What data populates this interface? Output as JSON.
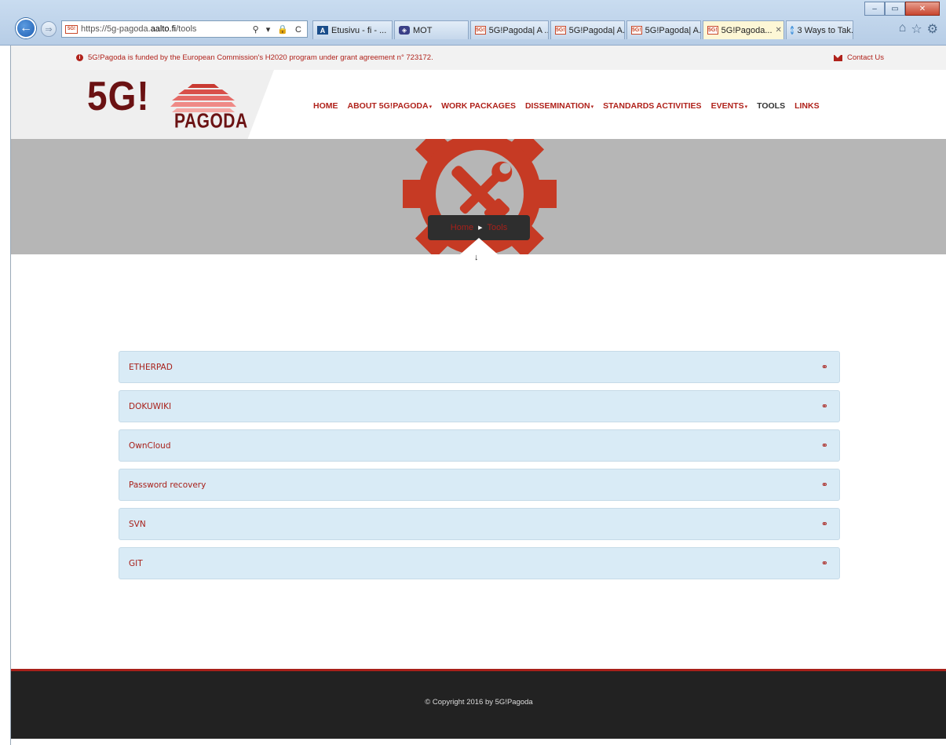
{
  "browser": {
    "url_prefix": "https://5g-pagoda.",
    "url_host": "aalto.fi",
    "url_path": "/tools",
    "address_icons": "⚲ ▾ 🔒 C",
    "favicon_text": "5G!",
    "tabs": [
      {
        "label": "Etusivu - fi - ...",
        "icon": "A",
        "active": false
      },
      {
        "label": "MOT",
        "icon": "mot",
        "active": false
      },
      {
        "label": "5G!Pagoda| A ...",
        "icon": "5G!",
        "active": false
      },
      {
        "label": "5G!Pagoda| A...",
        "icon": "5G!",
        "active": false
      },
      {
        "label": "5G!Pagoda| A...",
        "icon": "5G!",
        "active": false
      },
      {
        "label": "5G!Pagoda...",
        "icon": "5G!",
        "active": true
      },
      {
        "label": "3 Ways to Tak...",
        "icon": "ie",
        "active": false
      }
    ],
    "win_minimize": "–",
    "win_restore": "▭",
    "win_close": "✕"
  },
  "topbar": {
    "funding_text": "5G!Pagoda is funded by the European Commission's H2020 program under grant agreement n° 723172.",
    "contact_label": "Contact Us"
  },
  "logo": {
    "main": "5G!",
    "sub": "PAGODA"
  },
  "nav": {
    "items": [
      {
        "label": "HOME",
        "has_caret": false
      },
      {
        "label": "ABOUT 5G!PAGODA",
        "has_caret": true
      },
      {
        "label": "WORK PACKAGES",
        "has_caret": false
      },
      {
        "label": "DISSEMINATION",
        "has_caret": true
      },
      {
        "label": "STANDARDS ACTIVITIES",
        "has_caret": false
      },
      {
        "label": "EVENTS",
        "has_caret": true
      },
      {
        "label": "TOOLS",
        "has_caret": false,
        "current": true
      },
      {
        "label": "LINKS",
        "has_caret": false
      }
    ],
    "caret": "▾"
  },
  "breadcrumb": {
    "home": "Home",
    "separator": "▶",
    "current": "Tools",
    "scroll_arrow": "🡣"
  },
  "tools": [
    {
      "label": "ETHERPAD"
    },
    {
      "label": "DOKUWIKI"
    },
    {
      "label": "OwnCloud"
    },
    {
      "label": "Password recovery"
    },
    {
      "label": "SVN"
    },
    {
      "label": "GIT"
    }
  ],
  "link_icon": "🔗",
  "footer": {
    "copyright": "© Copyright 2016 by 5G!Pagoda"
  },
  "colors": {
    "brand_red": "#a8201a",
    "logo_maroon": "#6b1213",
    "panel_blue": "#d9ebf6",
    "footer_dark": "#222222"
  }
}
